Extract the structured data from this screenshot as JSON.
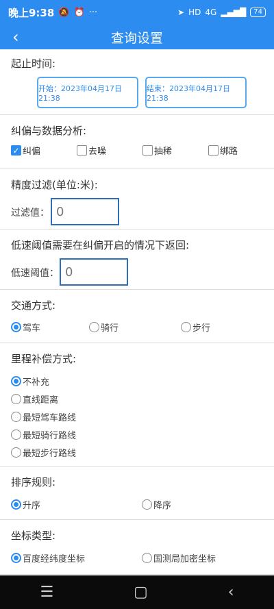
{
  "status_bar": {
    "time": "晚上9:38",
    "network": "4G",
    "hd": "HD",
    "battery": "74"
  },
  "app_bar": {
    "back_icon": "back-arrow-icon",
    "title": "查询设置"
  },
  "time_range": {
    "title": "起止时间:",
    "start": "开始：2023年04月17日 21:38",
    "end": "结束：2023年04月17日 21:38"
  },
  "correction": {
    "title": "纠偏与数据分析:",
    "options": [
      {
        "label": "纠偏",
        "checked": true
      },
      {
        "label": "去噪",
        "checked": false
      },
      {
        "label": "抽稀",
        "checked": false
      },
      {
        "label": "绑路",
        "checked": false
      }
    ]
  },
  "precision": {
    "title": "精度过滤(单位:米):",
    "label": "过滤值：",
    "value": "0"
  },
  "low_speed": {
    "title": "低速阈值需要在纠偏开启的情况下返回:",
    "label": "低速阈值：",
    "value": "0"
  },
  "transport": {
    "title": "交通方式:",
    "options": [
      {
        "label": "驾车",
        "selected": true
      },
      {
        "label": "骑行",
        "selected": false
      },
      {
        "label": "步行",
        "selected": false
      }
    ]
  },
  "mileage": {
    "title": "里程补偿方式:",
    "options": [
      {
        "label": "不补充",
        "selected": true
      },
      {
        "label": "直线距离",
        "selected": false
      },
      {
        "label": "最短驾车路线",
        "selected": false
      },
      {
        "label": "最短骑行路线",
        "selected": false
      },
      {
        "label": "最短步行路线",
        "selected": false
      }
    ]
  },
  "sort": {
    "title": "排序规则:",
    "options": [
      {
        "label": "升序",
        "selected": true
      },
      {
        "label": "降序",
        "selected": false
      }
    ]
  },
  "coord": {
    "title": "坐标类型:",
    "options": [
      {
        "label": "百度经纬度坐标",
        "selected": true
      },
      {
        "label": "国测局加密坐标",
        "selected": false
      }
    ]
  },
  "colors": {
    "primary": "#2d8cf0",
    "nav_bar": "#0b0b0b"
  }
}
